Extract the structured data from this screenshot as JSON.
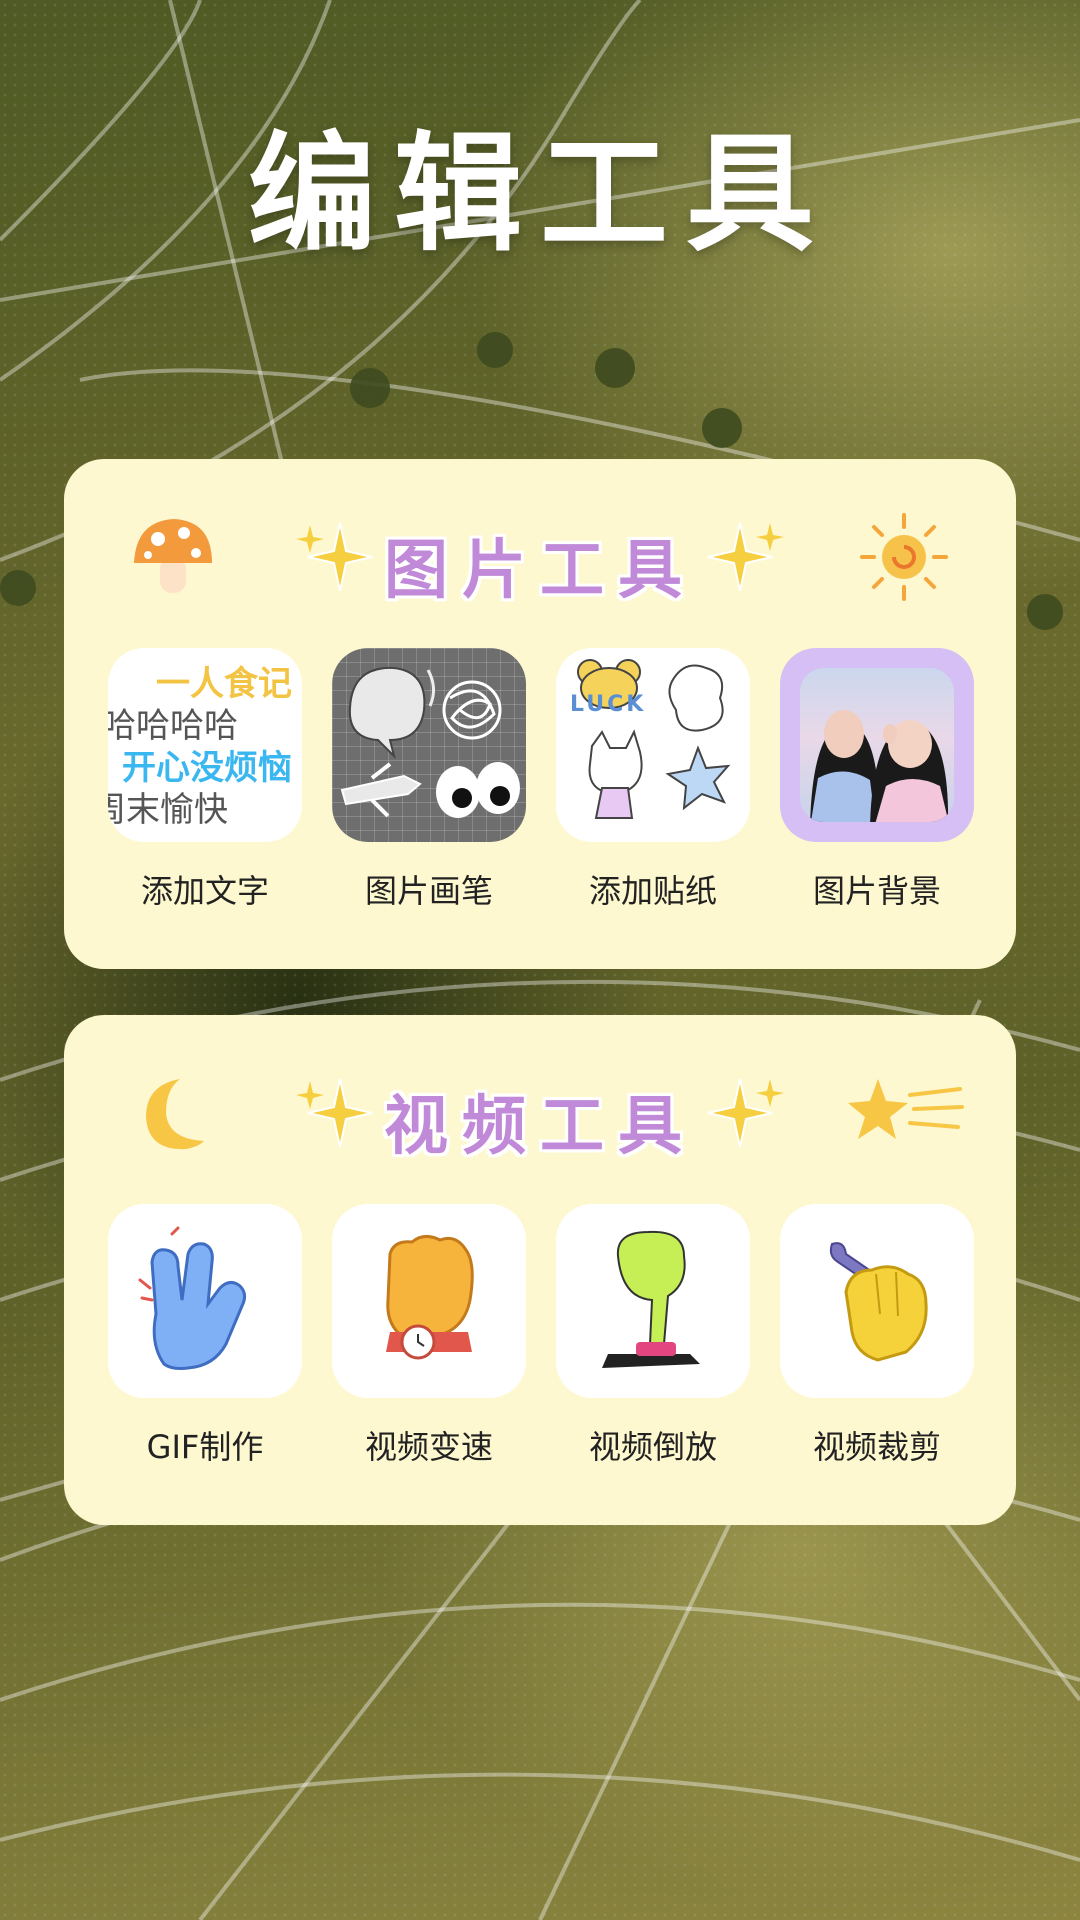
{
  "page": {
    "title": "编辑工具"
  },
  "image_tools": {
    "title": "图片工具",
    "items": [
      {
        "label": "添加文字",
        "icon": "text-icon",
        "preview_lines": [
          "一人食记",
          "哈哈哈哈",
          "开心没烦恼",
          "周末愉快"
        ]
      },
      {
        "label": "图片画笔",
        "icon": "brush-doodle-icon"
      },
      {
        "label": "添加贴纸",
        "icon": "sticker-icon",
        "sticker_text": "LUCK"
      },
      {
        "label": "图片背景",
        "icon": "photo-background-icon"
      }
    ]
  },
  "video_tools": {
    "title": "视频工具",
    "items": [
      {
        "label": "GIF制作",
        "icon": "hand-peace-icon"
      },
      {
        "label": "视频变速",
        "icon": "fist-watch-icon"
      },
      {
        "label": "视频倒放",
        "icon": "finger-press-button-icon"
      },
      {
        "label": "视频裁剪",
        "icon": "hand-wrench-icon"
      }
    ]
  },
  "colors": {
    "panel_bg": "#fdf8cf",
    "panel_title": "#c08ad8",
    "page_title": "#ffffff",
    "label_text": "#222222",
    "accent_blue": "#3ab7f0",
    "accent_yellow": "#f3c443"
  }
}
